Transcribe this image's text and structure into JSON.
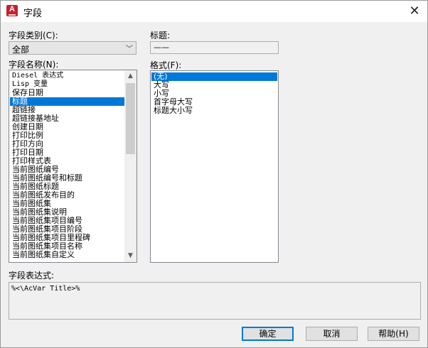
{
  "window": {
    "title": "字段",
    "app_icon_letter": "A"
  },
  "category": {
    "label": "字段类别(C):",
    "value": "全部"
  },
  "field_names": {
    "label": "字段名称(N):",
    "items": [
      "Diesel 表达式",
      "Lisp 变量",
      "保存日期",
      "标题",
      "超链接",
      "超链接基地址",
      "创建日期",
      "打印比例",
      "打印方向",
      "打印日期",
      "打印样式表",
      "当前图纸编号",
      "当前图纸编号和标题",
      "当前图纸标题",
      "当前图纸发布目的",
      "当前图纸集",
      "当前图纸集说明",
      "当前图纸集项目编号",
      "当前图纸集项目阶段",
      "当前图纸集项目里程碑",
      "当前图纸集项目名称",
      "当前图纸集自定义"
    ],
    "selected": "标题"
  },
  "title_field": {
    "label": "标题:",
    "value": "——"
  },
  "format": {
    "label": "格式(F):",
    "items": [
      "(无)",
      "大写",
      "小写",
      "首字母大写",
      "标题大小写"
    ],
    "selected": "(无)"
  },
  "expression": {
    "label": "字段表达式:",
    "value": "%<\\AcVar Title>%"
  },
  "buttons": {
    "ok": "确定",
    "cancel": "取消",
    "help": "帮助(H)"
  },
  "colors": {
    "selection": "#0078d7",
    "app_icon": "#c8202f"
  }
}
